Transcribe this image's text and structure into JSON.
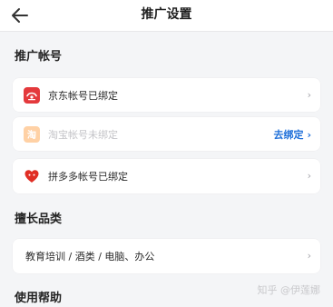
{
  "header": {
    "title": "推广设置",
    "back_icon": "arrow-left-icon"
  },
  "sections": {
    "promo_accounts": {
      "title": "推广帐号",
      "items": [
        {
          "label": "京东帐号已绑定",
          "icon": "jd-logo-icon",
          "icon_color": "#e4393c",
          "status": "bound"
        },
        {
          "label": "淘宝帐号未绑定",
          "icon": "taobao-logo-icon",
          "icon_color": "#ff9a3a",
          "status": "unbound",
          "action_label": "去绑定"
        },
        {
          "label": "拼多多帐号已绑定",
          "icon": "pinduoduo-logo-icon",
          "icon_color": "#e02e24",
          "status": "bound"
        }
      ]
    },
    "categories": {
      "title": "擅长品类",
      "value": "教育培训 / 酒类 / 电脑、办公"
    },
    "help": {
      "title": "使用帮助"
    }
  },
  "chevron": "›",
  "watermark": "知乎 @伊莲娜",
  "colors": {
    "background": "#f4f5f7",
    "link": "#1e6fd9"
  }
}
